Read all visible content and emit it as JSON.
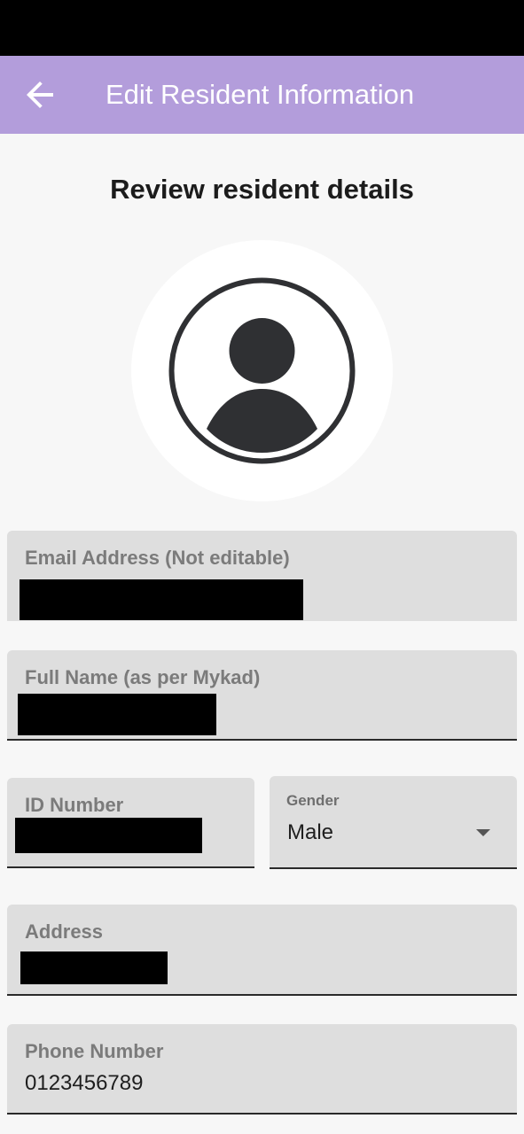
{
  "app_bar": {
    "title": "Edit Resident Information",
    "back_icon": "arrow-back-icon",
    "background": "#b39ddb"
  },
  "page": {
    "heading": "Review resident details",
    "avatar_icon": "person-avatar-icon"
  },
  "form": {
    "email": {
      "label": "Email Address (Not editable)",
      "value_redacted": true
    },
    "full_name": {
      "label": "Full Name (as per Mykad)",
      "value_redacted": true
    },
    "id_number": {
      "label": "ID Number",
      "value_redacted": true
    },
    "gender": {
      "label": "Gender",
      "value": "Male",
      "icon": "dropdown-arrow-icon"
    },
    "address": {
      "label": "Address",
      "value_redacted": true
    },
    "phone": {
      "label": "Phone Number",
      "value": "0123456789"
    }
  }
}
